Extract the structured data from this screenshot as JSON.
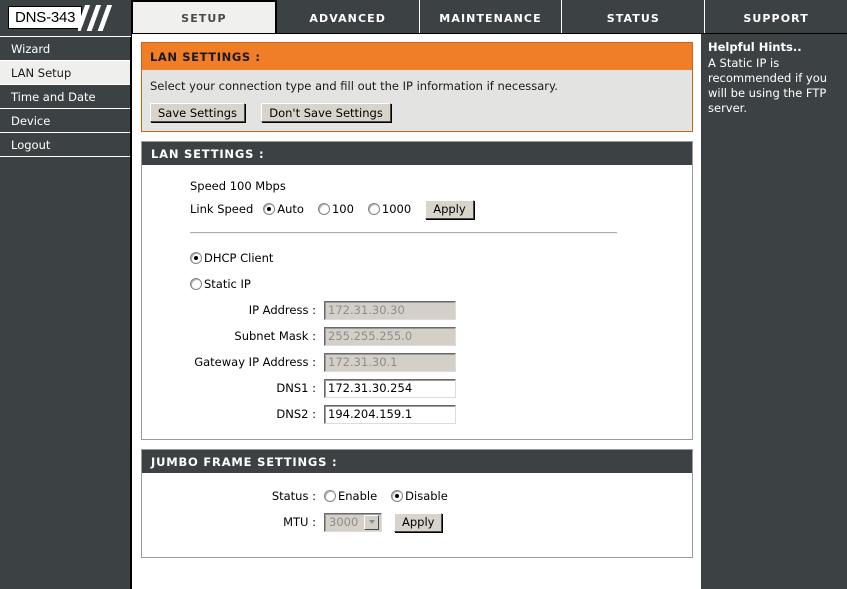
{
  "brand": {
    "model": "DNS-343"
  },
  "nav": {
    "tabs": [
      {
        "label": "SETUP",
        "active": true
      },
      {
        "label": "ADVANCED",
        "active": false
      },
      {
        "label": "MAINTENANCE",
        "active": false
      },
      {
        "label": "STATUS",
        "active": false
      },
      {
        "label": "SUPPORT",
        "active": false
      }
    ]
  },
  "sidebar": {
    "items": [
      {
        "label": "Wizard",
        "active": false
      },
      {
        "label": "LAN Setup",
        "active": true
      },
      {
        "label": "Time and Date",
        "active": false
      },
      {
        "label": "Device",
        "active": false
      },
      {
        "label": "Logout",
        "active": false
      }
    ]
  },
  "hints": {
    "title": "Helpful Hints..",
    "body": "A Static IP is recommended if you will be using the FTP server."
  },
  "header_panel": {
    "title": "LAN SETTINGS :",
    "description": "Select your connection type and fill out the IP information if necessary.",
    "save_label": "Save Settings",
    "dont_save_label": "Don't Save Settings"
  },
  "lan_settings": {
    "title": "LAN SETTINGS :",
    "speed_status": "Speed 100 Mbps",
    "link_speed_label": "Link Speed",
    "link_speed_options": [
      {
        "label": "Auto",
        "selected": true
      },
      {
        "label": "100",
        "selected": false
      },
      {
        "label": "1000",
        "selected": false
      }
    ],
    "link_speed_apply": "Apply",
    "connection_options": [
      {
        "label": "DHCP Client",
        "selected": true
      },
      {
        "label": "Static IP",
        "selected": false
      }
    ],
    "fields": [
      {
        "label": "IP Address :",
        "value": "172.31.30.30",
        "disabled": true
      },
      {
        "label": "Subnet Mask :",
        "value": "255.255.255.0",
        "disabled": true
      },
      {
        "label": "Gateway IP Address :",
        "value": "172.31.30.1",
        "disabled": true
      },
      {
        "label": "DNS1 :",
        "value": "172.31.30.254",
        "disabled": false
      },
      {
        "label": "DNS2 :",
        "value": "194.204.159.1",
        "disabled": false
      }
    ]
  },
  "jumbo_frame": {
    "title": "JUMBO FRAME SETTINGS :",
    "status_label": "Status :",
    "status_options": [
      {
        "label": "Enable",
        "selected": false
      },
      {
        "label": "Disable",
        "selected": true
      }
    ],
    "mtu_label": "MTU :",
    "mtu_value": "3000",
    "mtu_apply": "Apply"
  },
  "colors": {
    "accent_orange": "#f07d28",
    "dark_panel": "#3c4244",
    "active_tab_bg": "#f0f0ee"
  }
}
